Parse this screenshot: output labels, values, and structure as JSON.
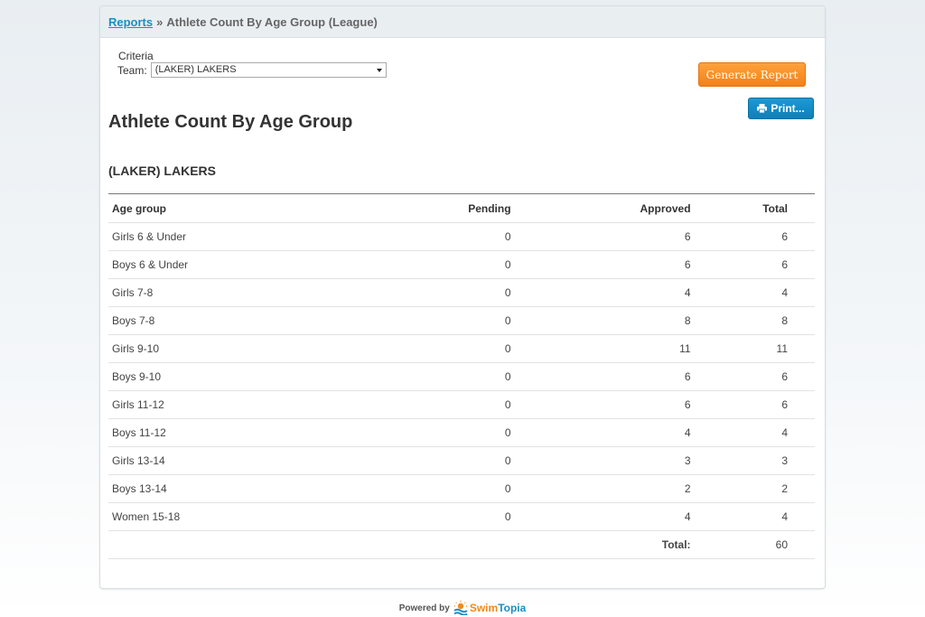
{
  "breadcrumb": {
    "link": "Reports",
    "separator": "»",
    "current": "Athlete Count By Age Group (League)"
  },
  "criteria": {
    "title": "Criteria",
    "team_label": "Team:",
    "team_value": "(LAKER) LAKERS"
  },
  "buttons": {
    "generate": "Generate Report",
    "print": "Print..."
  },
  "report": {
    "title": "Athlete Count By Age Group",
    "team": "(LAKER) LAKERS"
  },
  "table": {
    "headers": {
      "age": "Age group",
      "pending": "Pending",
      "approved": "Approved",
      "total": "Total"
    },
    "rows": [
      {
        "age": "Girls 6 & Under",
        "pending": "0",
        "approved": "6",
        "total": "6"
      },
      {
        "age": "Boys 6 & Under",
        "pending": "0",
        "approved": "6",
        "total": "6"
      },
      {
        "age": "Girls 7-8",
        "pending": "0",
        "approved": "4",
        "total": "4"
      },
      {
        "age": "Boys 7-8",
        "pending": "0",
        "approved": "8",
        "total": "8"
      },
      {
        "age": "Girls 9-10",
        "pending": "0",
        "approved": "11",
        "total": "11"
      },
      {
        "age": "Boys 9-10",
        "pending": "0",
        "approved": "6",
        "total": "6"
      },
      {
        "age": "Girls 11-12",
        "pending": "0",
        "approved": "6",
        "total": "6"
      },
      {
        "age": "Boys 11-12",
        "pending": "0",
        "approved": "4",
        "total": "4"
      },
      {
        "age": "Girls 13-14",
        "pending": "0",
        "approved": "3",
        "total": "3"
      },
      {
        "age": "Boys 13-14",
        "pending": "0",
        "approved": "2",
        "total": "2"
      },
      {
        "age": "Women 15-18",
        "pending": "0",
        "approved": "4",
        "total": "4"
      }
    ],
    "footer": {
      "label": "Total:",
      "value": "60"
    }
  },
  "footer": {
    "powered_by": "Powered by",
    "brand_part1": "Swim",
    "brand_part2": "Topia"
  },
  "colors": {
    "link": "#1a8fc4",
    "generate_button": "#f7901e",
    "print_button": "#1589c6",
    "brand_orange": "#f08a1c",
    "brand_blue": "#1a8fc4"
  },
  "icons": {
    "print": "printer-icon",
    "select": "chevron-down-icon",
    "brand": "swimtopia-logo-icon"
  }
}
